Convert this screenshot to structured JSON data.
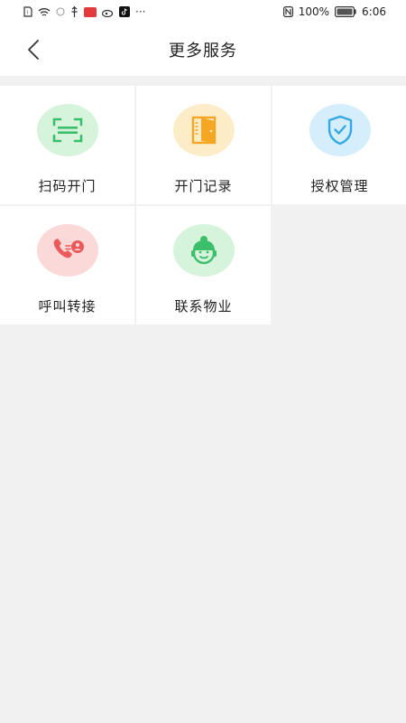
{
  "status_bar": {
    "battery": "100%",
    "time": "6:06",
    "ellipsis": "···"
  },
  "header": {
    "title": "更多服务"
  },
  "services": [
    {
      "label": "扫码开门",
      "icon": "scan-icon",
      "circle_color": "#d6f3dc"
    },
    {
      "label": "开门记录",
      "icon": "door-icon",
      "circle_color": "#fdecc8"
    },
    {
      "label": "授权管理",
      "icon": "shield-check-icon",
      "circle_color": "#d4eefb"
    },
    {
      "label": "呼叫转接",
      "icon": "phone-transfer-icon",
      "circle_color": "#fbd9d9"
    },
    {
      "label": "联系物业",
      "icon": "customer-service-icon",
      "circle_color": "#d6f3dc"
    }
  ],
  "colors": {
    "background": "#f1f1f1",
    "green": "#3cbf6a",
    "orange": "#f5a623",
    "blue": "#37a8e6",
    "red": "#ea5a5a"
  }
}
